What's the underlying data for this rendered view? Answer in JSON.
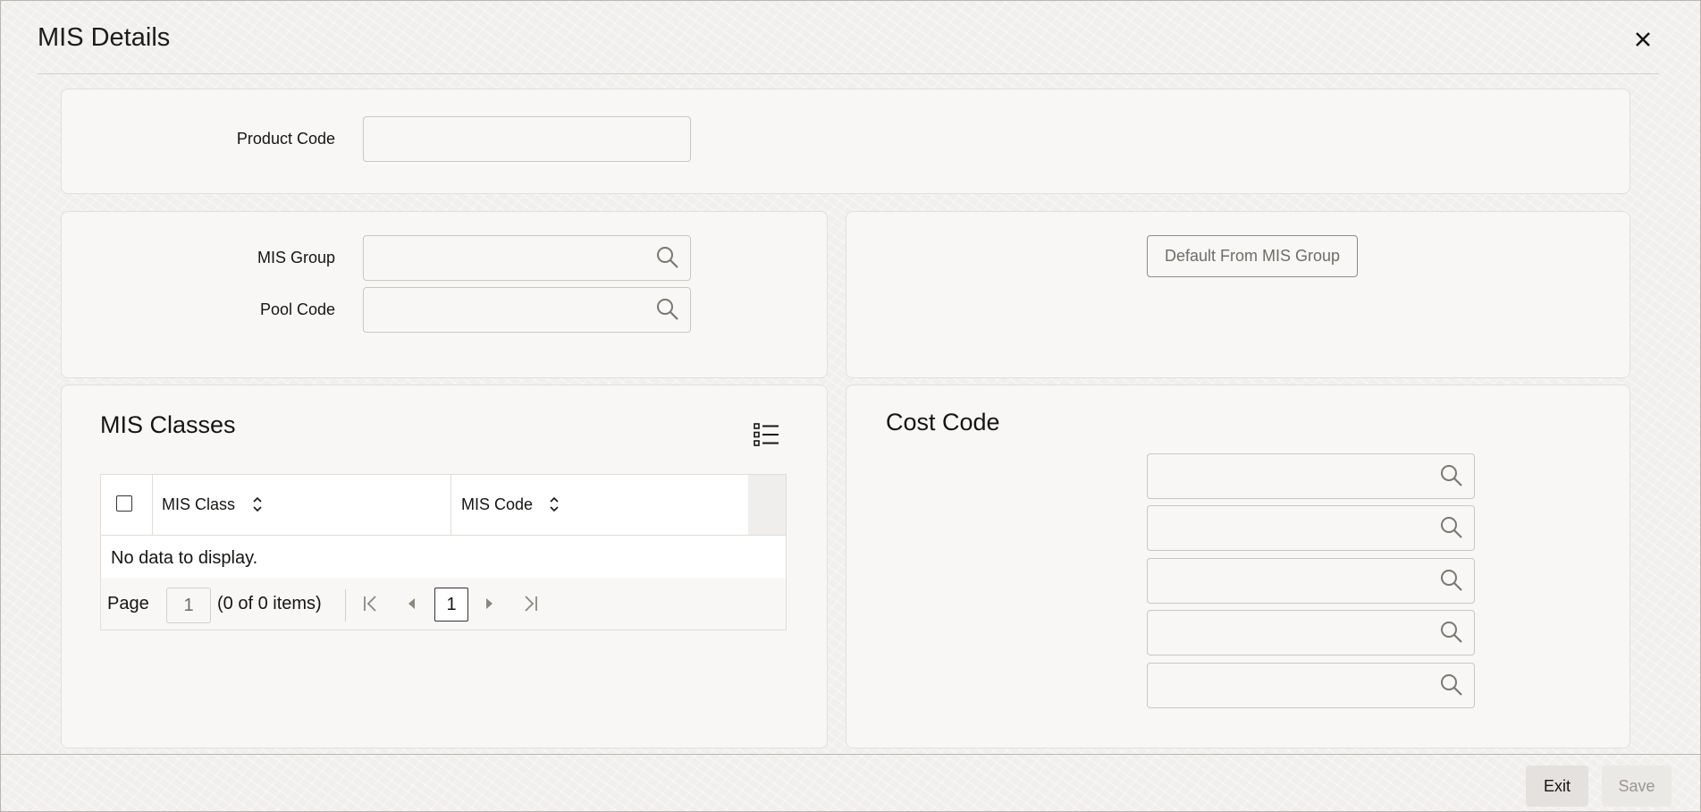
{
  "window": {
    "title": "MIS Details",
    "close_icon": "close-icon"
  },
  "product": {
    "label": "Product Code",
    "value": ""
  },
  "mis_group": {
    "label": "MIS Group",
    "value": ""
  },
  "pool_code": {
    "label": "Pool Code",
    "value": ""
  },
  "default_button": {
    "label": "Default From MIS Group"
  },
  "mis_classes": {
    "title": "MIS Classes",
    "columns": [
      "MIS Class",
      "MIS Code"
    ],
    "empty_text": "No data to display.",
    "pager": {
      "page_label": "Page",
      "page_value": "1",
      "items_text": "(0 of 0 items)",
      "current_page": "1"
    }
  },
  "cost_code": {
    "title": "Cost Code",
    "fields": [
      "",
      "",
      "",
      "",
      ""
    ]
  },
  "footer": {
    "exit_label": "Exit",
    "save_label": "Save"
  },
  "colors": {
    "accent": "#161513",
    "panel": "#f8f7f6",
    "border": "#c9c6c2"
  }
}
